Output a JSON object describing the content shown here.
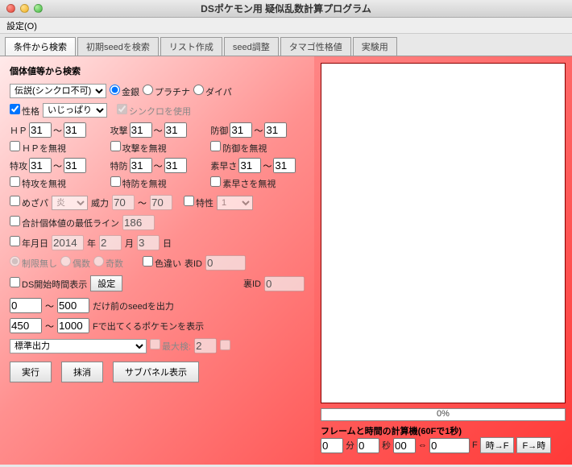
{
  "window": {
    "title": "DSポケモン用 疑似乱数計算プログラム"
  },
  "menu": {
    "settings": "設定(O)"
  },
  "tabs": [
    "条件から検索",
    "初期seedを検索",
    "リスト作成",
    "seed調整",
    "タマゴ性格値",
    "実験用"
  ],
  "left": {
    "header": "個体値等から検索",
    "type_select": "伝説(シンクロ不可)",
    "game_radios": {
      "gs": "金銀",
      "pt": "プラチナ",
      "dp": "ダイパ"
    },
    "nature_cb": "性格",
    "nature_sel": "いじっぱり",
    "sync_cb": "シンクロを使用",
    "stats": {
      "hp": {
        "lbl": "ＨＰ",
        "lo": "31",
        "hi": "31",
        "ig": "ＨＰを無視"
      },
      "atk": {
        "lbl": "攻撃",
        "lo": "31",
        "hi": "31",
        "ig": "攻撃を無視"
      },
      "def": {
        "lbl": "防御",
        "lo": "31",
        "hi": "31",
        "ig": "防御を無視"
      },
      "spa": {
        "lbl": "特攻",
        "lo": "31",
        "hi": "31",
        "ig": "特攻を無視"
      },
      "spd": {
        "lbl": "特防",
        "lo": "31",
        "hi": "31",
        "ig": "特防を無視"
      },
      "spe": {
        "lbl": "素早さ",
        "lo": "31",
        "hi": "31",
        "ig": "素早さを無視"
      }
    },
    "hp_power": {
      "lbl": "めざパ",
      "type": "炎",
      "pow_lbl": "威力",
      "pow_lo": "70",
      "pow_hi": "70",
      "ability_lbl": "特性",
      "ability": "1"
    },
    "total_iv": {
      "lbl": "合計個体値の最低ライン",
      "val": "186"
    },
    "date": {
      "lbl": "年月日",
      "y": "2014",
      "ylbl": "年",
      "m": "2",
      "mlbl": "月",
      "d": "3",
      "dlbl": "日"
    },
    "parity": {
      "none": "制限無し",
      "even": "偶数",
      "odd": "奇数"
    },
    "shiny": {
      "lbl": "色違い",
      "tid_lbl": "表ID",
      "tid": "0",
      "sid_lbl": "裏ID",
      "sid": "0"
    },
    "dstime": {
      "lbl": "DS開始時間表示",
      "btn": "設定"
    },
    "seed_range": {
      "lo": "0",
      "hi": "500",
      "suffix": "だけ前のseedを出力"
    },
    "frame_range": {
      "lo": "450",
      "hi": "1000",
      "suffix": "Fで出てくるポケモンを表示"
    },
    "output_sel": "標準出力",
    "max_show": {
      "lbl": "最大検:",
      "val": "2"
    },
    "buttons": {
      "run": "実行",
      "clear": "抹消",
      "sub": "サブパネル表示"
    }
  },
  "right": {
    "progress": "0%",
    "timecalc": {
      "title": "フレームと時間の計算機(60Fで1秒)",
      "min": "0",
      "min_lbl": "分",
      "sec": "0",
      "sec_lbl": "秒",
      "csec": "00",
      "arrow": "⇔",
      "frame": "0",
      "frame_lbl": "F",
      "btn_tf": "時→F",
      "btn_ft": "F→時"
    }
  }
}
